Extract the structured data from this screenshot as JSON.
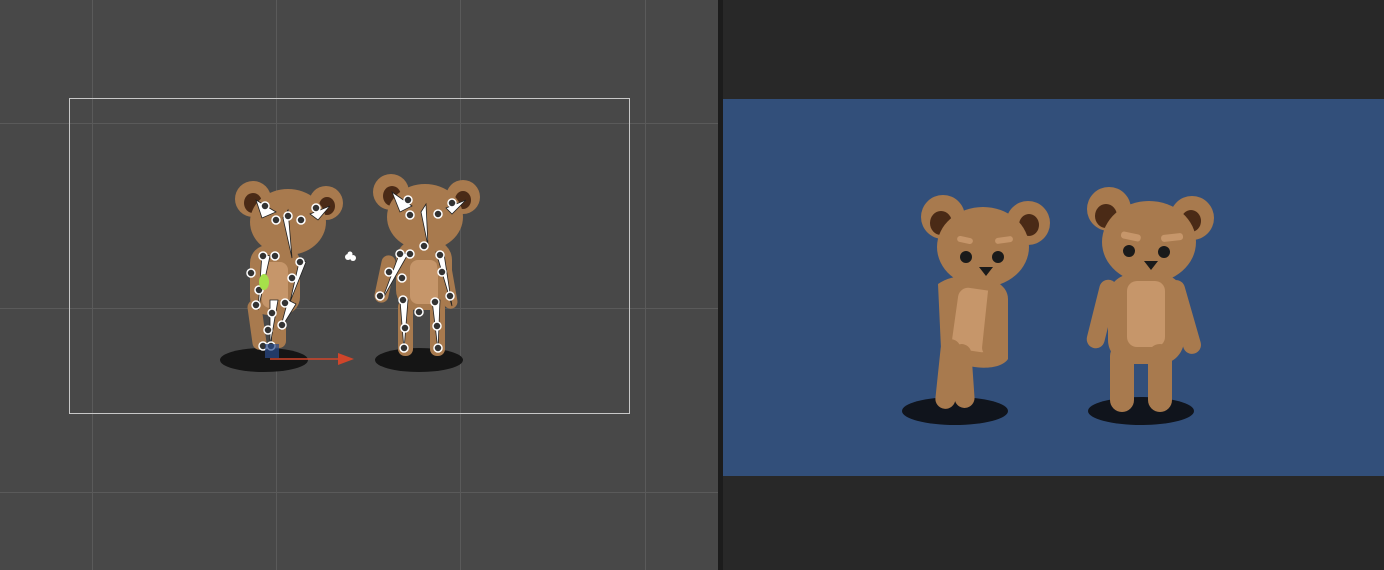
{
  "colors": {
    "scene_background": "#484848",
    "scene_grid": "#5a5a5a",
    "camera_frame": "#c8c8c8",
    "game_background": "#324f7a",
    "game_letterbox": "#282828",
    "bear_fur": "#a87a4e",
    "bear_belly": "#c6966a",
    "bear_ear_inner": "#4a2a16",
    "shadow": "#10141c",
    "move_tool_x_axis": "#d0452a",
    "move_tool_y_axis": "#a6e04a"
  },
  "scene_view": {
    "objects": [
      {
        "name": "bear-left",
        "pose": "leaning",
        "bones_visible": true
      },
      {
        "name": "bear-right",
        "pose": "standing",
        "bones_visible": true
      }
    ],
    "camera_icon": "light-gizmo-icon",
    "tool": "move-tool"
  },
  "game_view": {
    "objects": [
      {
        "name": "bear-left",
        "pose": "leaning"
      },
      {
        "name": "bear-right",
        "pose": "standing"
      }
    ]
  }
}
